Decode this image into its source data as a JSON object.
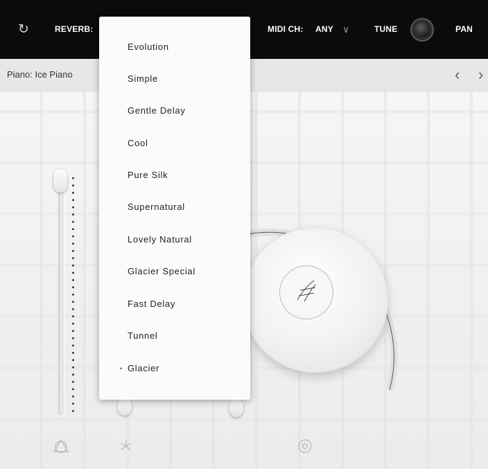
{
  "topbar": {
    "refresh_icon": "refresh-icon",
    "reverb_label": "REVERB:",
    "midi_label": "MIDI CH:",
    "midi_value": "ANY",
    "midi_chevron": "chevron-down-icon",
    "tune_label": "TUNE",
    "pan_label": "PAN"
  },
  "preset": {
    "name": "Piano: Ice Piano",
    "prev_icon": "chevron-left-icon",
    "next_icon": "chevron-right-icon"
  },
  "reverb_menu": {
    "items": [
      {
        "label": "Evolution"
      },
      {
        "label": "Simple"
      },
      {
        "label": "Gentle Delay"
      },
      {
        "label": "Cool"
      },
      {
        "label": "Pure Silk"
      },
      {
        "label": "Supernatural"
      },
      {
        "label": "Lovely Natural"
      },
      {
        "label": "Glacier Special"
      },
      {
        "label": "Fast Delay"
      },
      {
        "label": "Tunnel"
      },
      {
        "label": "Glacier"
      }
    ],
    "selected": "Glacier"
  },
  "icons": {
    "bottom_left": "triangle-circle-icon",
    "bottom_middle": "spiral-icon",
    "bottom_right": "target-icon",
    "dial_center": "texture-icon"
  },
  "colors": {
    "topbar": "#0b0b0b",
    "menu_bg": "#fbfbfb",
    "text": "#222222"
  }
}
